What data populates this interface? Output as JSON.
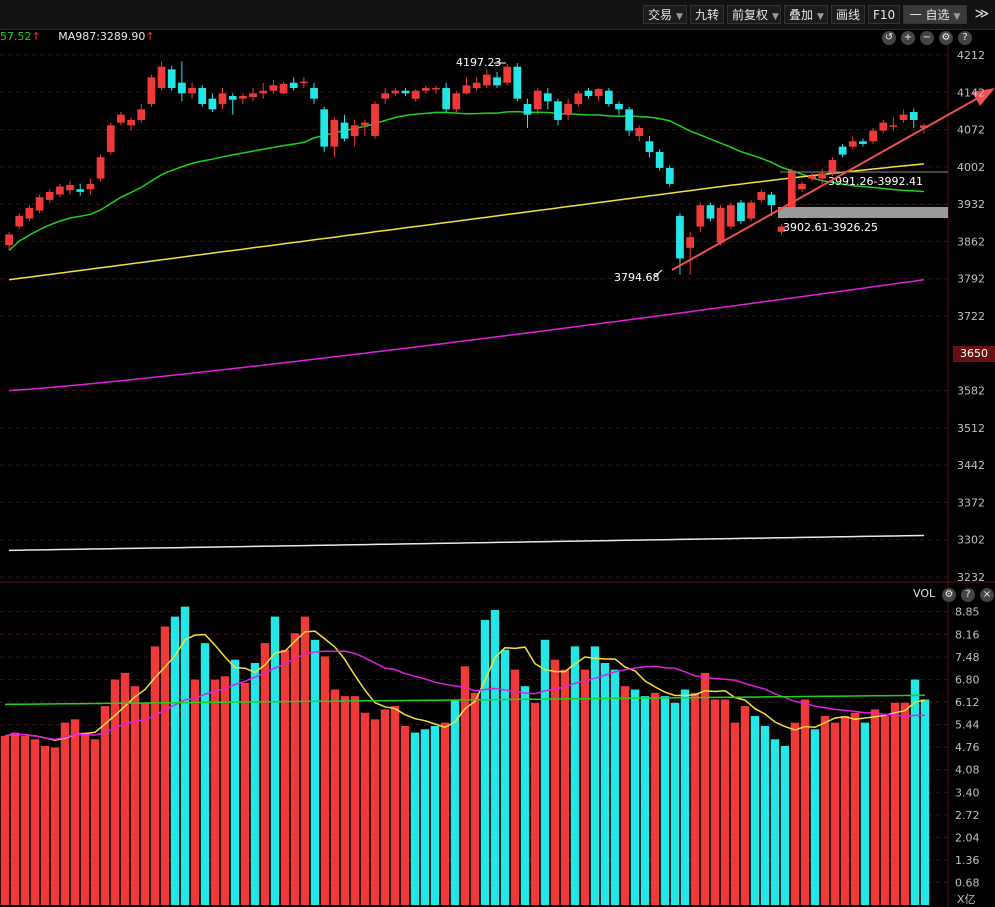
{
  "toolbar": {
    "buttons": [
      {
        "label": "交易",
        "caret": true
      },
      {
        "label": "九转",
        "caret": false
      },
      {
        "label": "前复权",
        "caret": true
      },
      {
        "label": "叠加",
        "caret": true
      },
      {
        "label": "画线",
        "caret": false
      },
      {
        "label": "F10",
        "caret": false
      },
      {
        "label": "一 自选",
        "caret": true
      }
    ],
    "more": "≫"
  },
  "ma_legend": {
    "partial_value": "57.52",
    "ma987": "MA987:3289.90",
    "up_arrow": "↑"
  },
  "price_axis": [
    "4212",
    "4142",
    "4072",
    "4002",
    "3932",
    "3862",
    "3792",
    "3722",
    "3650",
    "3582",
    "3512",
    "3442",
    "3372",
    "3302",
    "3232"
  ],
  "current_price": "3650",
  "volume_axis": [
    "8.85",
    "8.16",
    "7.48",
    "6.80",
    "6.12",
    "5.44",
    "4.76",
    "4.08",
    "3.40",
    "2.72",
    "2.04",
    "1.36",
    "0.68"
  ],
  "volume_unit": "X亿",
  "volume_title": "VOL",
  "annotations": {
    "high": "4197.23",
    "low": "3794.68",
    "gap1": "3991.26-3992.41",
    "gap2": "3902.61-3926.25"
  },
  "colors": {
    "up": "#f03a3a",
    "down": "#24e6e6",
    "ma_green": "#1ed21e",
    "ma_yellow": "#f0e040",
    "ma_magenta": "#e020e0",
    "ma_white": "#e8e8e8",
    "trend_arrow": "#f05050",
    "gap_bar": "#9a9a9a"
  },
  "chart_data": {
    "type": "candlestick",
    "price_range": [
      3232,
      4212
    ],
    "volume_range": [
      0,
      9.2
    ],
    "candles": [
      [
        3855,
        3875,
        3845,
        3880,
        "up"
      ],
      [
        3890,
        3910,
        3885,
        3915,
        "up"
      ],
      [
        3905,
        3925,
        3900,
        3930,
        "up"
      ],
      [
        3920,
        3945,
        3915,
        3950,
        "up"
      ],
      [
        3940,
        3955,
        3935,
        3960,
        "up"
      ],
      [
        3950,
        3965,
        3945,
        3970,
        "up"
      ],
      [
        3958,
        3968,
        3950,
        3975,
        "up"
      ],
      [
        3955,
        3960,
        3948,
        3970,
        "down"
      ],
      [
        3960,
        3970,
        3950,
        3980,
        "up"
      ],
      [
        3980,
        4020,
        3975,
        4025,
        "up"
      ],
      [
        4030,
        4080,
        4025,
        4085,
        "up"
      ],
      [
        4085,
        4100,
        4080,
        4105,
        "up"
      ],
      [
        4080,
        4090,
        4070,
        4095,
        "up"
      ],
      [
        4090,
        4110,
        4085,
        4120,
        "up"
      ],
      [
        4120,
        4170,
        4115,
        4175,
        "up"
      ],
      [
        4150,
        4190,
        4145,
        4200,
        "up"
      ],
      [
        4185,
        4150,
        4145,
        4192,
        "down"
      ],
      [
        4160,
        4140,
        4125,
        4200,
        "down"
      ],
      [
        4140,
        4150,
        4130,
        4160,
        "up"
      ],
      [
        4150,
        4120,
        4115,
        4155,
        "down"
      ],
      [
        4130,
        4110,
        4105,
        4140,
        "down"
      ],
      [
        4120,
        4140,
        4110,
        4150,
        "up"
      ],
      [
        4135,
        4128,
        4100,
        4140,
        "down"
      ],
      [
        4130,
        4135,
        4120,
        4140,
        "up"
      ],
      [
        4133,
        4140,
        4125,
        4150,
        "up"
      ],
      [
        4140,
        4145,
        4130,
        4160,
        "up"
      ],
      [
        4145,
        4155,
        4140,
        4165,
        "up"
      ],
      [
        4140,
        4158,
        4138,
        4162,
        "up"
      ],
      [
        4160,
        4150,
        4145,
        4170,
        "down"
      ],
      [
        4160,
        4162,
        4150,
        4170,
        "up"
      ],
      [
        4150,
        4130,
        4120,
        4160,
        "down"
      ],
      [
        4110,
        4040,
        4030,
        4115,
        "down"
      ],
      [
        4040,
        4090,
        4020,
        4095,
        "up"
      ],
      [
        4085,
        4055,
        4050,
        4100,
        "down"
      ],
      [
        4060,
        4080,
        4040,
        4090,
        "up"
      ],
      [
        4080,
        4085,
        4060,
        4090,
        "up"
      ],
      [
        4060,
        4120,
        4055,
        4125,
        "up"
      ],
      [
        4130,
        4140,
        4120,
        4150,
        "up"
      ],
      [
        4140,
        4145,
        4135,
        4150,
        "up"
      ],
      [
        4145,
        4140,
        4135,
        4150,
        "down"
      ],
      [
        4130,
        4145,
        4125,
        4148,
        "up"
      ],
      [
        4145,
        4150,
        4140,
        4155,
        "up"
      ],
      [
        4150,
        4150,
        4140,
        4155,
        "up"
      ],
      [
        4150,
        4110,
        4105,
        4160,
        "down"
      ],
      [
        4110,
        4140,
        4105,
        4145,
        "up"
      ],
      [
        4140,
        4155,
        4138,
        4170,
        "up"
      ],
      [
        4150,
        4160,
        4145,
        4170,
        "up"
      ],
      [
        4155,
        4175,
        4150,
        4185,
        "up"
      ],
      [
        4170,
        4155,
        4150,
        4180,
        "down"
      ],
      [
        4160,
        4190,
        4155,
        4195,
        "up"
      ],
      [
        4190,
        4130,
        4125,
        4197,
        "down"
      ],
      [
        4120,
        4100,
        4075,
        4130,
        "down"
      ],
      [
        4110,
        4145,
        4100,
        4150,
        "up"
      ],
      [
        4140,
        4125,
        4110,
        4150,
        "down"
      ],
      [
        4125,
        4090,
        4080,
        4130,
        "down"
      ],
      [
        4100,
        4120,
        4090,
        4130,
        "up"
      ],
      [
        4120,
        4140,
        4115,
        4145,
        "up"
      ],
      [
        4145,
        4135,
        4130,
        4150,
        "down"
      ],
      [
        4135,
        4148,
        4125,
        4150,
        "up"
      ],
      [
        4145,
        4120,
        4115,
        4150,
        "down"
      ],
      [
        4120,
        4110,
        4100,
        4125,
        "down"
      ],
      [
        4110,
        4070,
        4060,
        4115,
        "down"
      ],
      [
        4075,
        4060,
        4050,
        4080,
        "up"
      ],
      [
        4050,
        4030,
        4020,
        4060,
        "down"
      ],
      [
        4030,
        4000,
        3995,
        4035,
        "down"
      ],
      [
        4000,
        3970,
        3965,
        4005,
        "down"
      ],
      [
        3910,
        3830,
        3800,
        3915,
        "down"
      ],
      [
        3850,
        3870,
        3800,
        3880,
        "up"
      ],
      [
        3890,
        3930,
        3880,
        3935,
        "up"
      ],
      [
        3930,
        3905,
        3900,
        3935,
        "down"
      ],
      [
        3860,
        3925,
        3855,
        3930,
        "up"
      ],
      [
        3890,
        3930,
        3885,
        3935,
        "up"
      ],
      [
        3935,
        3900,
        3895,
        3940,
        "down"
      ],
      [
        3905,
        3935,
        3900,
        3940,
        "up"
      ],
      [
        3940,
        3955,
        3935,
        3960,
        "up"
      ],
      [
        3950,
        3930,
        3910,
        3955,
        "down"
      ],
      [
        3890,
        3880,
        3875,
        3895,
        "up"
      ],
      [
        3920,
        3995,
        3915,
        3998,
        "up"
      ],
      [
        3970,
        3960,
        3955,
        3975,
        "up"
      ],
      [
        3985,
        3980,
        3975,
        3990,
        "up"
      ],
      [
        3990,
        3980,
        3970,
        3998,
        "up"
      ],
      [
        3990,
        4015,
        3985,
        4020,
        "up"
      ],
      [
        4025,
        4040,
        4020,
        4045,
        "down"
      ],
      [
        4040,
        4050,
        4035,
        4060,
        "up"
      ],
      [
        4050,
        4045,
        4040,
        4055,
        "down"
      ],
      [
        4050,
        4070,
        4045,
        4075,
        "up"
      ],
      [
        4070,
        4085,
        4065,
        4090,
        "up"
      ],
      [
        4080,
        4080,
        4070,
        4095,
        "up"
      ],
      [
        4090,
        4100,
        4085,
        4110,
        "up"
      ],
      [
        4105,
        4090,
        4075,
        4112,
        "down"
      ],
      [
        4075,
        4080,
        4065,
        4082,
        "up"
      ]
    ],
    "volumes": [
      [
        5.1,
        "up"
      ],
      [
        5.2,
        "up"
      ],
      [
        5.1,
        "up"
      ],
      [
        5.0,
        "up"
      ],
      [
        4.8,
        "up"
      ],
      [
        4.75,
        "up"
      ],
      [
        5.5,
        "up"
      ],
      [
        5.6,
        "up"
      ],
      [
        5.2,
        "up"
      ],
      [
        5.0,
        "up"
      ],
      [
        6.0,
        "up"
      ],
      [
        6.8,
        "up"
      ],
      [
        7.0,
        "up"
      ],
      [
        6.6,
        "up"
      ],
      [
        6.1,
        "up"
      ],
      [
        7.8,
        "up"
      ],
      [
        8.4,
        "up"
      ],
      [
        8.7,
        "down"
      ],
      [
        9.0,
        "down"
      ],
      [
        6.8,
        "up"
      ],
      [
        7.9,
        "down"
      ],
      [
        6.8,
        "up"
      ],
      [
        6.9,
        "up"
      ],
      [
        7.4,
        "down"
      ],
      [
        6.7,
        "up"
      ],
      [
        7.3,
        "down"
      ],
      [
        7.9,
        "up"
      ],
      [
        8.7,
        "down"
      ],
      [
        7.7,
        "up"
      ],
      [
        8.2,
        "up"
      ],
      [
        8.7,
        "up"
      ],
      [
        8.0,
        "down"
      ],
      [
        7.5,
        "up"
      ],
      [
        6.5,
        "up"
      ],
      [
        6.3,
        "up"
      ],
      [
        6.3,
        "up"
      ],
      [
        5.8,
        "up"
      ],
      [
        5.6,
        "up"
      ],
      [
        5.9,
        "up"
      ],
      [
        6.0,
        "up"
      ],
      [
        5.4,
        "up"
      ],
      [
        5.2,
        "down"
      ],
      [
        5.3,
        "down"
      ],
      [
        5.4,
        "down"
      ],
      [
        5.5,
        "up"
      ],
      [
        6.2,
        "down"
      ],
      [
        7.2,
        "up"
      ],
      [
        6.4,
        "up"
      ],
      [
        8.6,
        "down"
      ],
      [
        8.9,
        "down"
      ],
      [
        7.7,
        "down"
      ],
      [
        7.1,
        "up"
      ],
      [
        6.6,
        "down"
      ],
      [
        6.1,
        "up"
      ],
      [
        8.0,
        "down"
      ],
      [
        7.4,
        "up"
      ],
      [
        7.1,
        "up"
      ],
      [
        7.8,
        "down"
      ],
      [
        7.1,
        "up"
      ],
      [
        7.8,
        "down"
      ],
      [
        7.3,
        "down"
      ],
      [
        7.1,
        "down"
      ],
      [
        6.6,
        "up"
      ],
      [
        6.5,
        "down"
      ],
      [
        6.3,
        "down"
      ],
      [
        6.4,
        "up"
      ],
      [
        6.3,
        "down"
      ],
      [
        6.1,
        "down"
      ],
      [
        6.5,
        "down"
      ],
      [
        6.4,
        "up"
      ],
      [
        7.0,
        "up"
      ],
      [
        6.2,
        "up"
      ],
      [
        6.2,
        "up"
      ],
      [
        5.5,
        "up"
      ],
      [
        6.0,
        "up"
      ],
      [
        5.7,
        "down"
      ],
      [
        5.4,
        "down"
      ],
      [
        5.0,
        "down"
      ],
      [
        4.8,
        "down"
      ],
      [
        5.5,
        "up"
      ],
      [
        6.2,
        "up"
      ],
      [
        5.3,
        "down"
      ],
      [
        5.7,
        "up"
      ],
      [
        5.5,
        "up"
      ],
      [
        5.7,
        "up"
      ],
      [
        5.8,
        "up"
      ],
      [
        5.5,
        "down"
      ],
      [
        5.9,
        "up"
      ],
      [
        5.7,
        "up"
      ],
      [
        6.1,
        "up"
      ],
      [
        6.1,
        "up"
      ],
      [
        6.8,
        "down"
      ],
      [
        6.2,
        "down"
      ]
    ]
  }
}
